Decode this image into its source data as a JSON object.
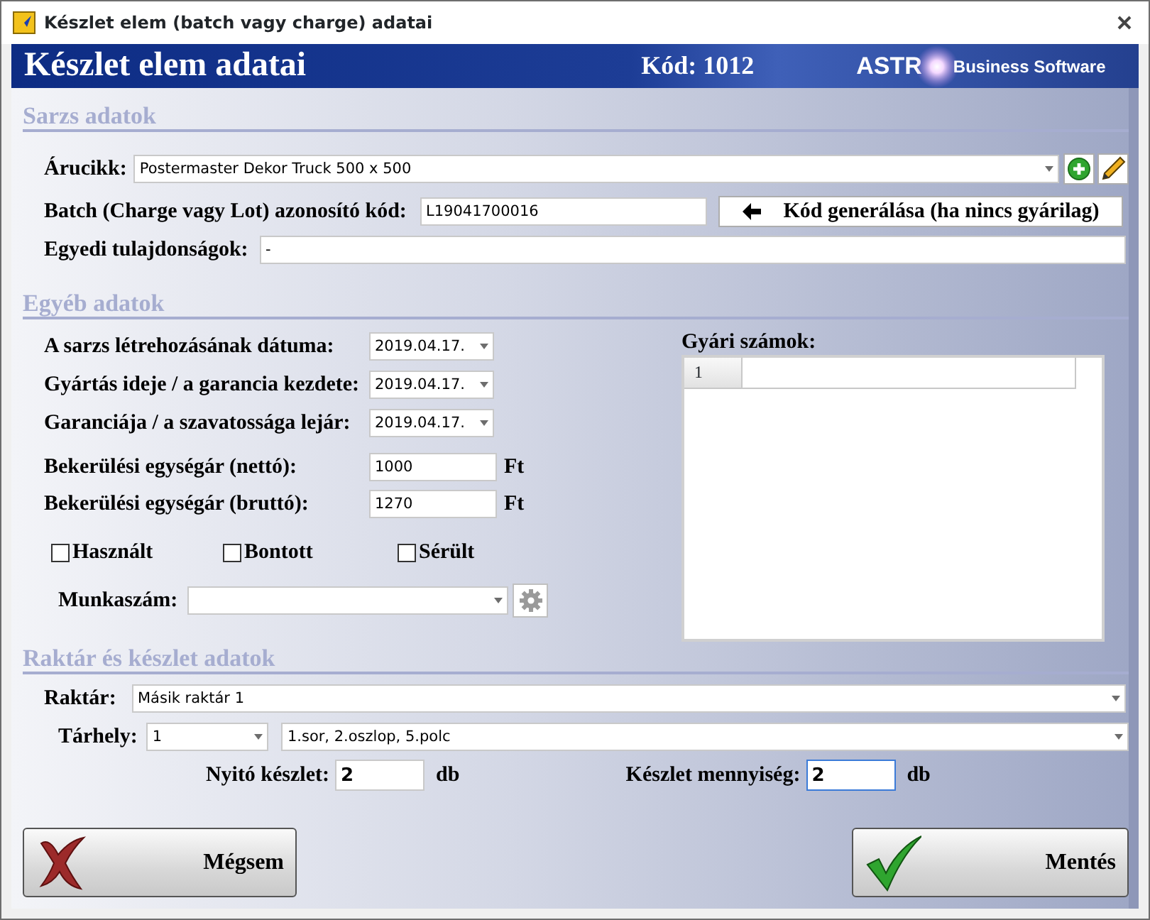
{
  "window": {
    "title": "Készlet elem (batch vagy charge) adatai"
  },
  "header": {
    "title": "Készlet elem adatai",
    "code": "Kód: 1012",
    "brand": "ASTR",
    "tagline": "Business Software"
  },
  "batch_section": {
    "heading": "Sarzs adatok",
    "product": {
      "label": "Árucikk:",
      "value": "Postermaster Dekor Truck  500 x 500"
    },
    "batch_code": {
      "label": "Batch (Charge vagy Lot) azonosító kód:",
      "value": "L19041700016",
      "button": "Kód generálása (ha nincs gyárilag)"
    },
    "properties": {
      "label": "Egyedi tulajdonságok:",
      "value": "-"
    }
  },
  "other_section": {
    "heading": "Egyéb adatok",
    "dates": [
      {
        "label": "A sarzs létrehozásának dátuma:",
        "value": "2019.04.17."
      },
      {
        "label": "Gyártás ideje / a garancia kezdete:",
        "value": "2019.04.17."
      },
      {
        "label": "Garanciája / a szavatossága lejár:",
        "value": "2019.04.17."
      }
    ],
    "prices": [
      {
        "label": "Bekerülési egységár (nettó):",
        "value": "1000",
        "unit": "Ft"
      },
      {
        "label": "Bekerülési egységár (bruttó):",
        "value": "1270",
        "unit": "Ft"
      }
    ],
    "flags": [
      {
        "label": "Használt",
        "checked": false
      },
      {
        "label": "Bontott",
        "checked": false
      },
      {
        "label": "Sérült",
        "checked": false
      }
    ],
    "job": {
      "label": "Munkaszám:"
    },
    "serials": {
      "label": "Gyári számok:",
      "rows": [
        {
          "number": "1"
        }
      ]
    }
  },
  "storage_section": {
    "heading": "Raktár és készlet adatok",
    "warehouse": {
      "label": "Raktár:",
      "value": "Másik raktár 1"
    },
    "location": {
      "label": "Tárhely:",
      "slot": "1",
      "description": "1.sor, 2.oszlop, 5.polc"
    },
    "opening": {
      "label": "Nyitó készlet:",
      "value": "2",
      "unit": "db",
      "focused": false
    },
    "quantity": {
      "label": "Készlet mennyiség:",
      "value": "2",
      "unit": "db",
      "focused": true
    }
  },
  "buttons": [
    {
      "kind": "cancel",
      "label": "Mégsem"
    },
    {
      "kind": "save",
      "label": "Mentés"
    }
  ]
}
